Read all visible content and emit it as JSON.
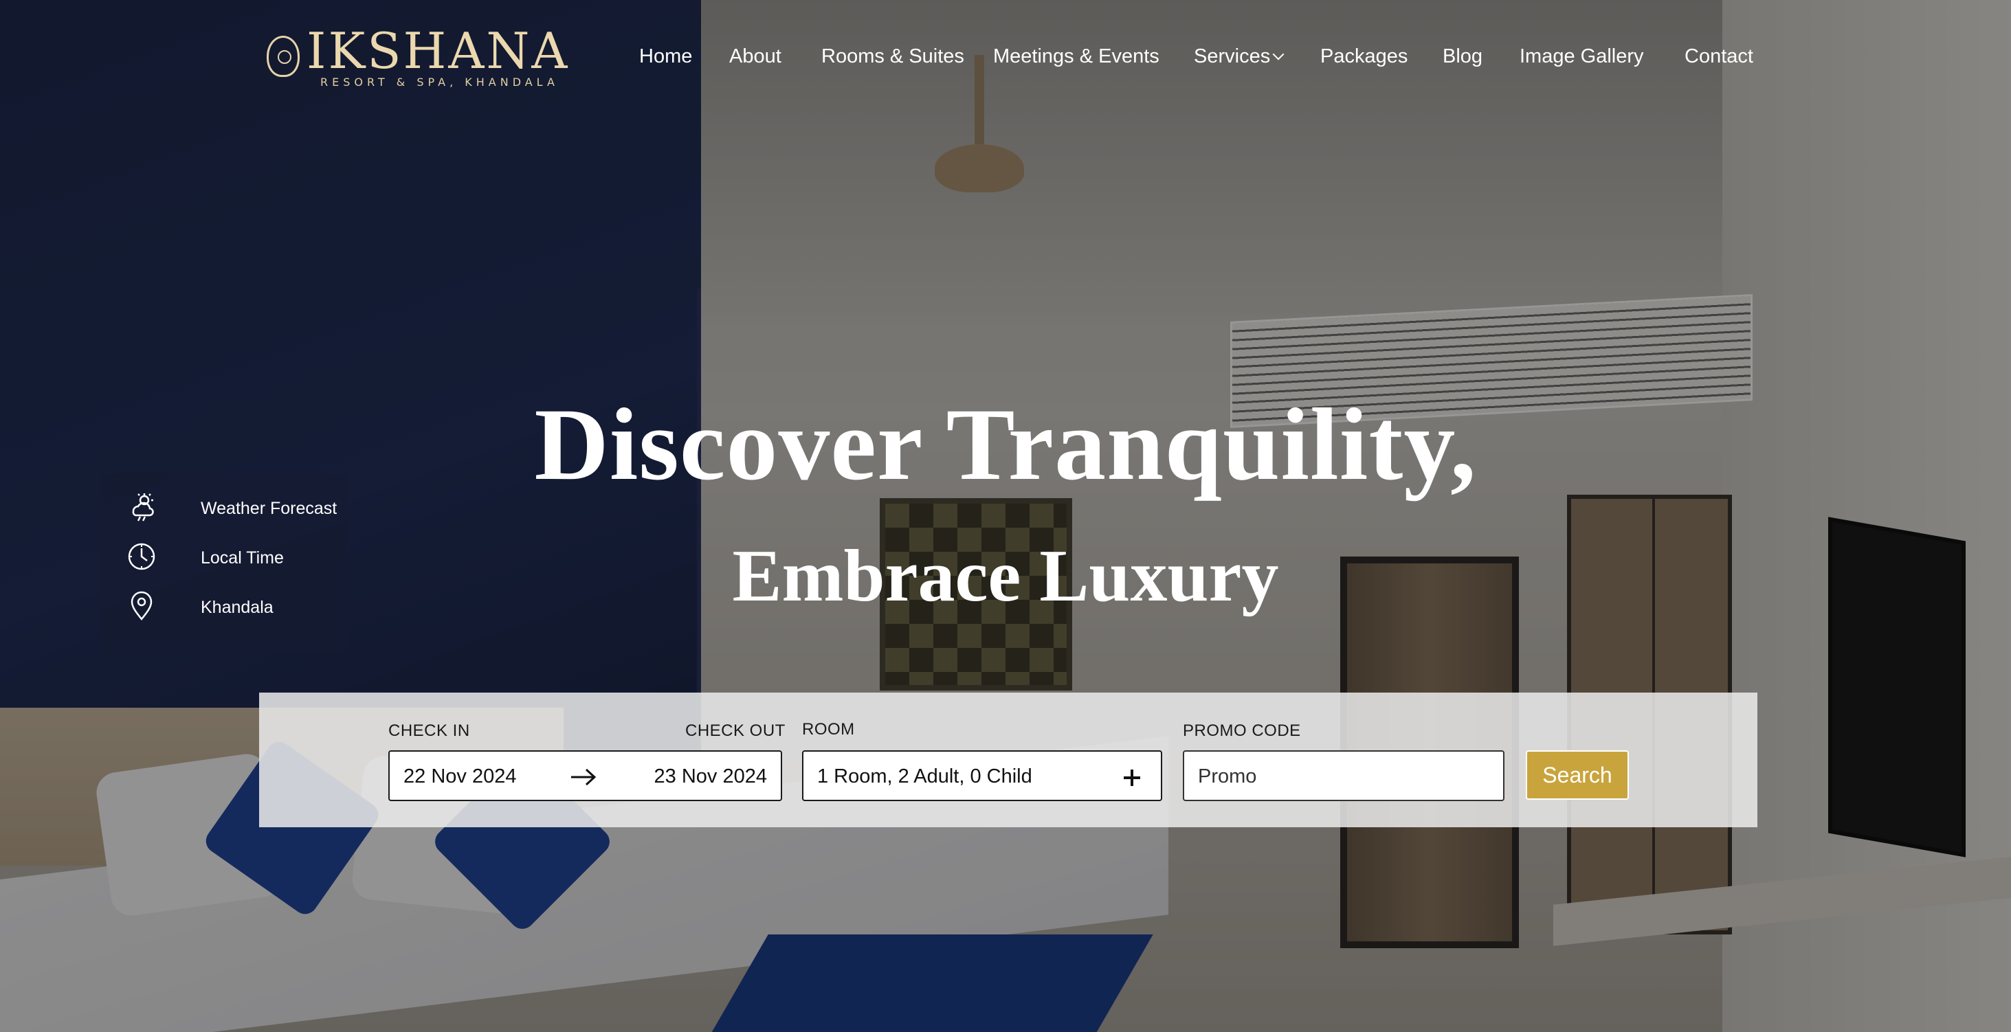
{
  "brand": {
    "name": "IKSHANA",
    "tagline": "RESORT & SPA, KHANDALA",
    "accent_color": "#c9a43c",
    "logo_color": "#ecd8ae"
  },
  "nav": {
    "items": [
      {
        "label": "Home"
      },
      {
        "label": "About"
      },
      {
        "label": "Rooms & Suites"
      },
      {
        "label": "Meetings & Events"
      },
      {
        "label": "Services",
        "has_dropdown": true
      },
      {
        "label": "Packages"
      },
      {
        "label": "Blog"
      },
      {
        "label": "Image Gallery"
      },
      {
        "label": "Contact"
      }
    ]
  },
  "info_panel": {
    "weather": {
      "icon": "weather-icon",
      "label": "Weather Forecast"
    },
    "time": {
      "icon": "clock-icon",
      "label": "Local Time"
    },
    "location": {
      "icon": "location-pin-icon",
      "label": "Khandala"
    }
  },
  "hero": {
    "title": "Discover Tranquility,",
    "subtitle": "Embrace Luxury"
  },
  "booking": {
    "check_in_label": "CHECK IN",
    "check_in_value": "22 Nov 2024",
    "check_out_label": "CHECK OUT",
    "check_out_value": "23 Nov 2024",
    "arrow_icon": "arrow-right-icon",
    "room_label": "ROOM",
    "room_value": "1 Room, 2 Adult, 0 Child",
    "room_add_icon": "plus-icon",
    "promo_label": "PROMO CODE",
    "promo_placeholder": "Promo",
    "search_label": "Search"
  }
}
